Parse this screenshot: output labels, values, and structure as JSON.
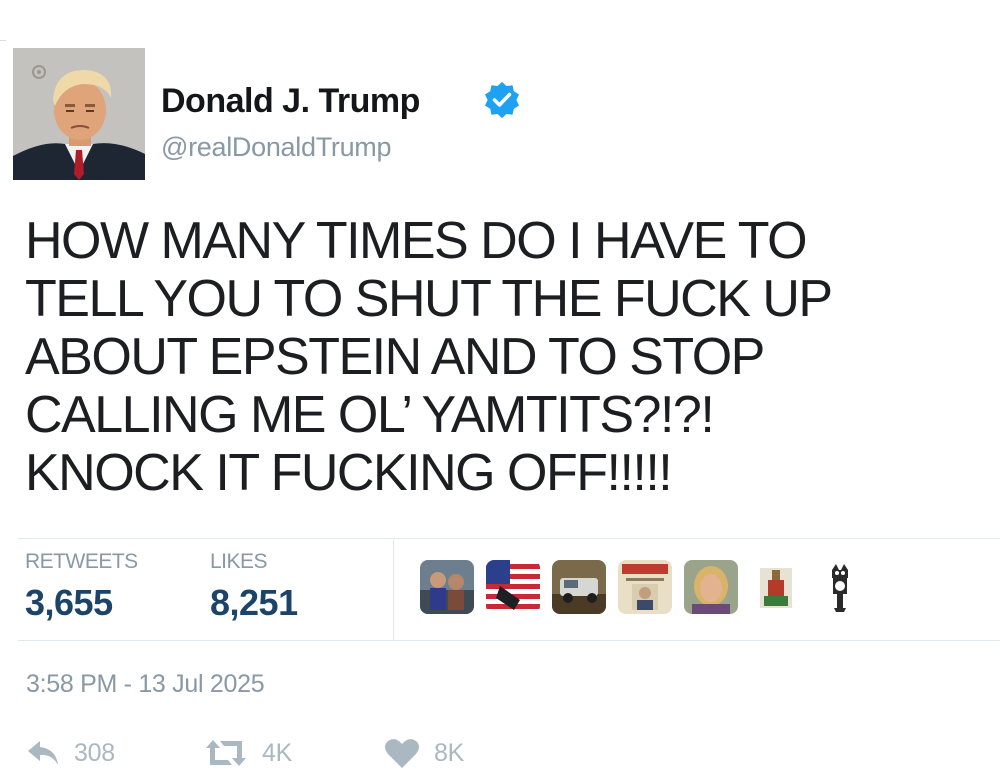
{
  "author": {
    "display_name": "Donald J. Trump",
    "handle": "@realDonaldTrump",
    "verified": true,
    "avatar_icon": "mugshot-photo"
  },
  "tweet": {
    "text": "HOW MANY TIMES DO I HAVE TO\nTELL YOU TO SHUT THE FUCK UP\nABOUT EPSTEIN AND TO STOP\nCALLING ME  OL’ YAMTITS?!?!\nKNOCK IT FUCKING OFF!!!!!",
    "timestamp": "3:58 PM - 13 Jul 2025"
  },
  "stats": {
    "retweets_label": "RETWEETS",
    "retweets_value": "3,655",
    "likes_label": "LIKES",
    "likes_value": "8,251"
  },
  "likers": [
    {
      "icon": "liker-avatar-people-photo"
    },
    {
      "icon": "liker-avatar-flag-photo"
    },
    {
      "icon": "liker-avatar-truck-photo"
    },
    {
      "icon": "liker-avatar-poster-photo"
    },
    {
      "icon": "liker-avatar-woman-photo"
    },
    {
      "icon": "liker-avatar-figure-photo"
    },
    {
      "icon": "liker-avatar-cat-clock"
    }
  ],
  "actions": {
    "reply_count": "308",
    "retweet_count": "4K",
    "like_count": "8K"
  },
  "colors": {
    "verified_blue": "#1da1f2",
    "count_navy": "#1b4468",
    "muted_gray": "#8899a6",
    "icon_gray": "#aab8c2"
  }
}
